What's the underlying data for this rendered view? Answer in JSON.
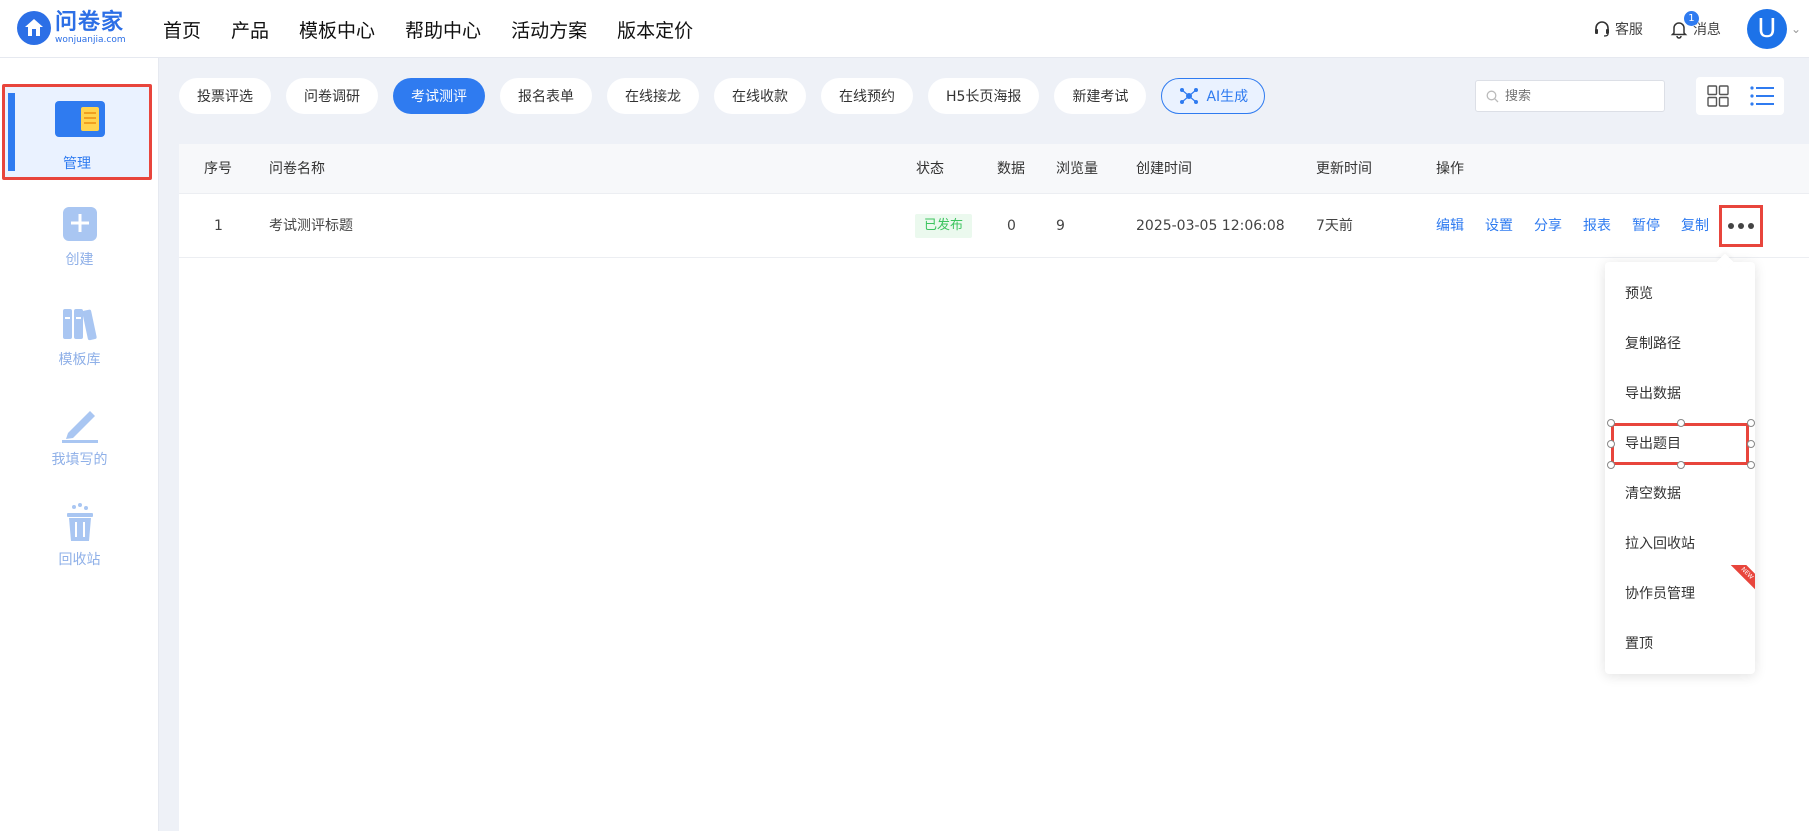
{
  "logo": {
    "cn": "问卷家",
    "en": "wonjuanjia.com"
  },
  "nav": [
    "首页",
    "产品",
    "模板中心",
    "帮助中心",
    "活动方案",
    "版本定价"
  ],
  "header": {
    "service_label": "客服",
    "message_label": "消息",
    "message_badge": "1",
    "avatar_letter": "U"
  },
  "sidebar": {
    "items": [
      {
        "label": "管理",
        "icon": "manage-icon",
        "active": true
      },
      {
        "label": "创建",
        "icon": "create-icon"
      },
      {
        "label": "模板库",
        "icon": "template-library-icon"
      },
      {
        "label": "我填写的",
        "icon": "pen-icon"
      },
      {
        "label": "回收站",
        "icon": "trash-icon"
      }
    ]
  },
  "tabs": [
    "投票评选",
    "问卷调研",
    "考试测评",
    "报名表单",
    "在线接龙",
    "在线收款",
    "在线预约",
    "H5长页海报",
    "新建考试",
    "AI生成"
  ],
  "active_tab": "考试测评",
  "search": {
    "placeholder": "搜索"
  },
  "table": {
    "headers": [
      "序号",
      "问卷名称",
      "状态",
      "数据",
      "浏览量",
      "创建时间",
      "更新时间",
      "操作"
    ],
    "rows": [
      {
        "index": "1",
        "name": "考试测评标题",
        "status": "已发布",
        "data": "0",
        "views": "9",
        "created": "2025-03-05 12:06:08",
        "updated": "7天前"
      }
    ],
    "operations": [
      "编辑",
      "设置",
      "分享",
      "报表",
      "暂停",
      "复制"
    ]
  },
  "dropdown": {
    "items": [
      "预览",
      "复制路径",
      "导出数据",
      "导出题目",
      "清空数据",
      "拉入回收站",
      "协作员管理",
      "置顶"
    ],
    "highlighted": "导出题目",
    "new_badge": "NEW"
  },
  "colors": {
    "primary": "#2f7bf0",
    "highlight": "#e8453c",
    "success": "#3cc45f"
  }
}
